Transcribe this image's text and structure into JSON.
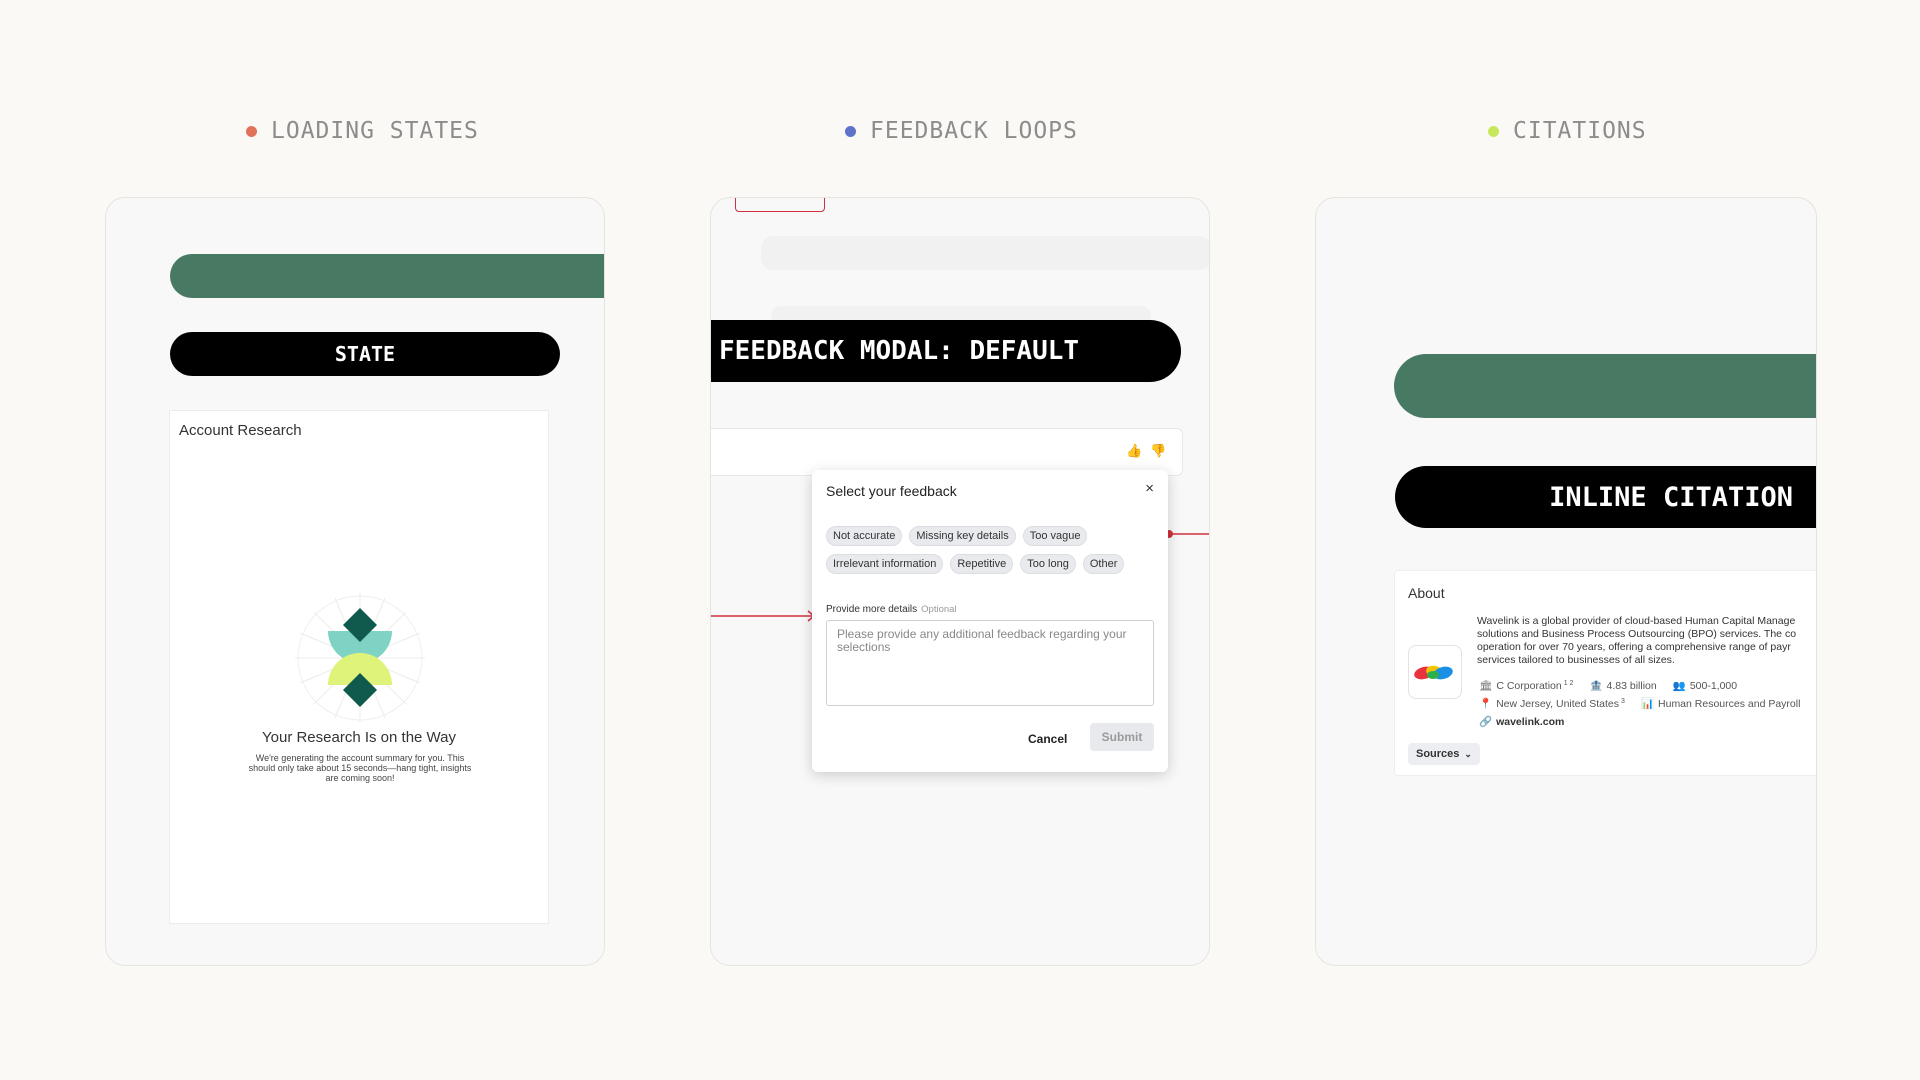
{
  "sections": {
    "loading": {
      "label": "LOADING STATES",
      "dot_color": "#e0735a"
    },
    "feedback": {
      "label": "FEEDBACK LOOPS",
      "dot_color": "#5e72c9"
    },
    "citations": {
      "label": "CITATIONS",
      "dot_color": "#c7e85a"
    }
  },
  "loading_panel": {
    "pill_label": "STATE",
    "card_title": "Account Research",
    "loader_title": "Your Research Is on the Way",
    "loader_subtitle": "We're generating the account summary for you. This should only take about 15 seconds—hang tight, insights are coming soon!"
  },
  "feedback_panel": {
    "pill_label": "FEEDBACK MODAL: DEFAULT",
    "modal": {
      "title": "Select your feedback",
      "close_symbol": "×",
      "chips": [
        "Not accurate",
        "Missing key details",
        "Too vague",
        "Irrelevant information",
        "Repetitive",
        "Too long",
        "Other"
      ],
      "details_label": "Provide more details",
      "details_optional": "Optional",
      "details_placeholder": "Please provide any additional feedback regarding your selections",
      "cancel_label": "Cancel",
      "submit_label": "Submit"
    },
    "accent_color": "#d0313c"
  },
  "citation_panel": {
    "pill_label": "INLINE CITATION",
    "about": {
      "title": "About",
      "description_lines": [
        "Wavelink is a global provider of cloud-based Human Capital Manage",
        "solutions and Business Process Outsourcing (BPO) services. The co",
        "operation for over 70 years, offering a comprehensive range of payr",
        "services tailored to businesses of all sizes."
      ],
      "entity_type": "C Corporation",
      "entity_type_refs": "1 2",
      "revenue": "4.83 billion",
      "employees": "500-1,000",
      "location": "New Jersey, United States",
      "location_ref": "3",
      "industry": "Human Resources and Payroll",
      "website": "wavelink.com",
      "sources_label": "Sources"
    }
  },
  "colors": {
    "green_bar": "#487a63",
    "pill_bg": "#000000"
  }
}
